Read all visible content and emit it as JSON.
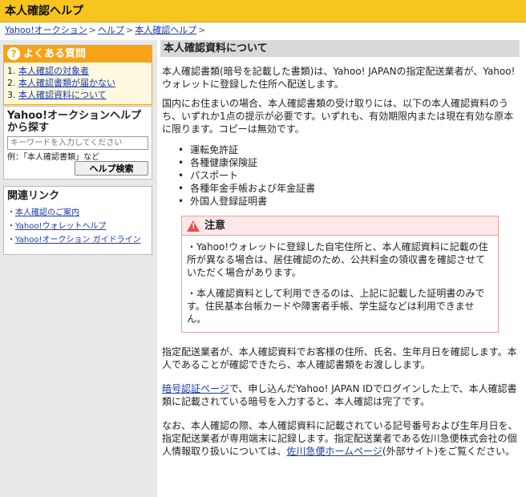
{
  "header": {
    "title": "本人確認ヘルプ"
  },
  "breadcrumb": {
    "items": [
      "Yahoo!オークション",
      "ヘルプ",
      "本人確認ヘルプ"
    ],
    "separator": ">"
  },
  "sidebar": {
    "faq": {
      "icon_glyph": "?",
      "title": "よくある質問",
      "items": [
        {
          "num": "1.",
          "label": "本人確認の対象者"
        },
        {
          "num": "2.",
          "label": "本人確認書類が届かない"
        },
        {
          "num": "3.",
          "label": "本人確認資料について"
        }
      ]
    },
    "search": {
      "title": "Yahoo!オークションヘルプから探す",
      "placeholder": "キーワードを入力してください",
      "example": "例：「本人確認書類」など",
      "button_label": "ヘルプ検索"
    },
    "related": {
      "title": "関連リンク",
      "items": [
        "本人確認のご案内",
        "Yahoo!ウォレットヘルプ",
        "Yahoo!オークション ガイドライン"
      ]
    }
  },
  "main": {
    "section_title": "本人確認資料について",
    "intro": "本人確認書類(暗号を記載した書類)は、Yahoo! JAPANの指定配送業者が、Yahoo!ウォレットに登録した住所へ配送します。",
    "requirement": "国内にお住まいの場合、本人確認書類の受け取りには、以下の本人確認資料のうち、いずれか1点の提示が必要です。いずれも、有効期限内または現在有効な原本に限ります。コピーは無効です。",
    "documents": [
      "運転免許証",
      "各種健康保険証",
      "パスポート",
      "各種年金手帳および年金証書",
      "外国人登録証明書"
    ],
    "caution": {
      "title": "注意",
      "p1": "・Yahoo!ウォレットに登録した自宅住所と、本人確認資料に記載の住所が異なる場合は、居住確認のため、公共料金の領収書を確認させていただく場合があります。",
      "p2": "・本人確認資料として利用できるのは、上記に記載した証明書のみです。住民基本台帳カードや障害者手帳、学生証などは利用できません。"
    },
    "delivery": "指定配送業者が、本人確認資料でお客様の住所、氏名、生年月日を確認します。本人であることが確認できたら、本人確認書類をお渡しします。",
    "auth": {
      "link": "暗号認証ページ",
      "text": "で、申し込んだYahoo! JAPAN IDでログインした上で、本人確認書類に記載されている暗号を入力すると、本人確認は完了です。"
    },
    "privacy": {
      "text1": "なお、本人確認の際、本人確認資料に記載されている記号番号および生年月日を、指定配送業者が専用端末に記録します。指定配送業者である佐川急便株式会社の個人情報取り扱いについては、",
      "link": "佐川急便ホームページ",
      "text2": "(外部サイト)をご覧ください。"
    }
  }
}
